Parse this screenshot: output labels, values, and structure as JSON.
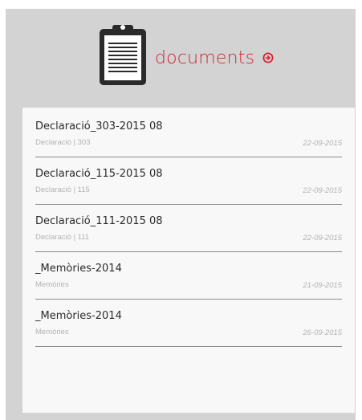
{
  "header": {
    "title": "documents",
    "icon": "clipboard-icon",
    "link_icon": "circle-arrow-right-icon",
    "accent_color": "#d22630"
  },
  "documents": [
    {
      "title": "Declaració_303-2015 08",
      "meta": "Declaració | 303",
      "date": "22-09-2015"
    },
    {
      "title": "Declaració_115-2015 08",
      "meta": "Declaració | 115",
      "date": "22-09-2015"
    },
    {
      "title": "Declaració_111-2015 08",
      "meta": "Declaració | 111",
      "date": "22-09-2015"
    },
    {
      "title": "_Memòries-2014",
      "meta": "Memòries",
      "date": "21-09-2015"
    },
    {
      "title": "_Memòries-2014",
      "meta": "Memòries",
      "date": "26-09-2015"
    }
  ]
}
